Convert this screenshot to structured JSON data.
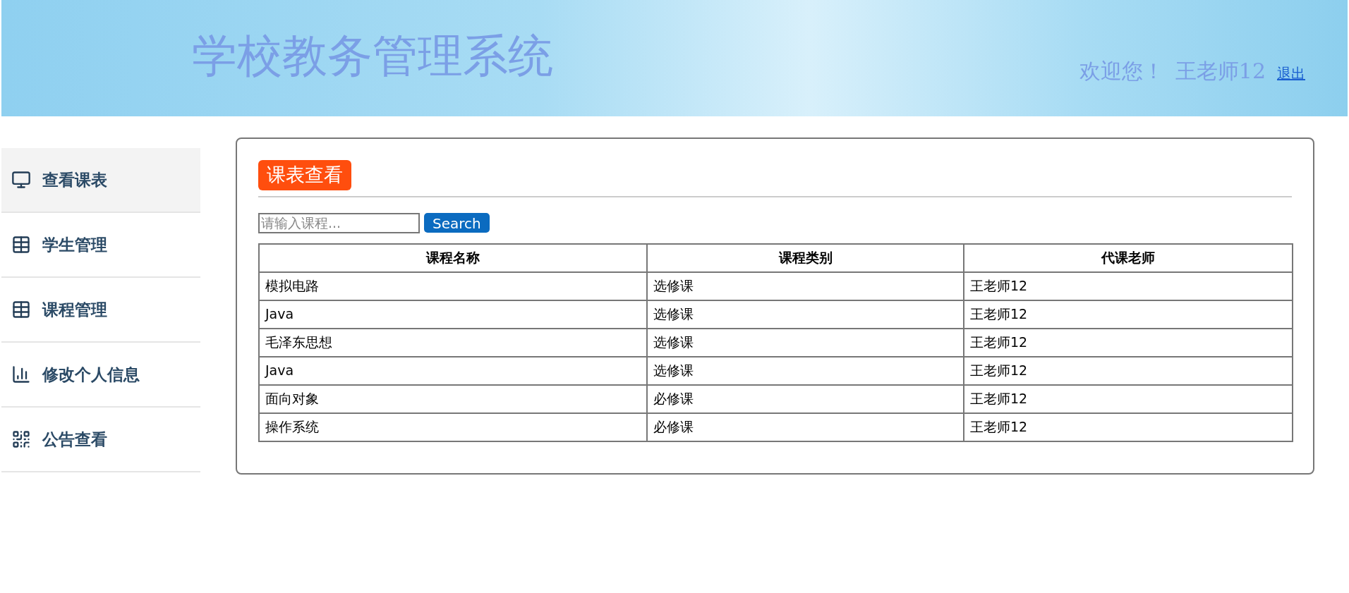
{
  "header": {
    "title": "学校教务管理系统",
    "welcome": "欢迎您！",
    "user": "王老师12",
    "logout": "退出"
  },
  "sidebar": {
    "items": [
      {
        "label": "查看课表",
        "selected": true
      },
      {
        "label": "学生管理",
        "selected": false
      },
      {
        "label": "课程管理",
        "selected": false
      },
      {
        "label": "修改个人信息",
        "selected": false
      },
      {
        "label": "公告查看",
        "selected": false
      }
    ]
  },
  "panel": {
    "title": "课表查看",
    "search": {
      "placeholder": "请输入课程...",
      "button": "Search"
    },
    "table": {
      "columns": [
        "课程名称",
        "课程类别",
        "代课老师"
      ],
      "rows": [
        [
          "模拟电路",
          "选修课",
          "王老师12"
        ],
        [
          "Java",
          "选修课",
          "王老师12"
        ],
        [
          "毛泽东思想",
          "选修课",
          "王老师12"
        ],
        [
          "Java",
          "选修课",
          "王老师12"
        ],
        [
          "面向对象",
          "必修课",
          "王老师12"
        ],
        [
          "操作系统",
          "必修课",
          "王老师12"
        ]
      ]
    }
  }
}
